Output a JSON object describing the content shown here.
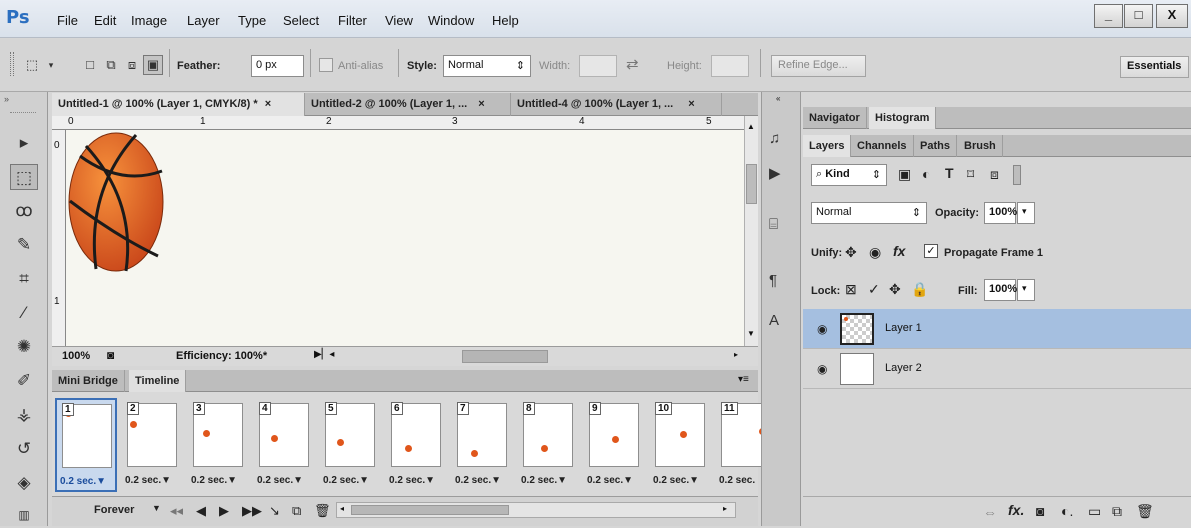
{
  "app": {
    "logo": "Ps"
  },
  "menu": [
    "File",
    "Edit",
    "Image",
    "Layer",
    "Type",
    "Select",
    "Filter",
    "View",
    "Window",
    "Help"
  ],
  "window_controls": {
    "minimize": "_",
    "maximize": "□",
    "close": "X"
  },
  "options": {
    "feather_label": "Feather:",
    "feather_value": "0 px",
    "antialias_label": "Anti-alias",
    "style_label": "Style:",
    "style_value": "Normal",
    "width_label": "Width:",
    "height_label": "Height:",
    "refine_edge": "Refine Edge...",
    "workspace": "Essentials"
  },
  "document_tabs": [
    {
      "label": "Untitled-1 @ 100% (Layer 1, CMYK/8) *",
      "close": "×"
    },
    {
      "label": "Untitled-2 @ 100% (Layer 1, ...",
      "close": "×"
    },
    {
      "label": "Untitled-4 @ 100% (Layer 1, ...",
      "close": "×"
    }
  ],
  "ruler": {
    "top": [
      "0",
      "1",
      "2",
      "3",
      "4",
      "5"
    ],
    "left": [
      "0",
      "1"
    ]
  },
  "status": {
    "zoom": "100%",
    "efficiency": "Efficiency: 100%*"
  },
  "panel_tabs": {
    "mini_bridge": "Mini Bridge",
    "timeline": "Timeline"
  },
  "frames": [
    {
      "num": "1",
      "time": "0.2 sec.▼",
      "ball_x": 0.05,
      "ball_y": 0.08
    },
    {
      "num": "2",
      "time": "0.2 sec.▼",
      "ball_x": 0.05,
      "ball_y": 0.3
    },
    {
      "num": "3",
      "time": "0.2 sec.▼",
      "ball_x": 0.2,
      "ball_y": 0.45
    },
    {
      "num": "4",
      "time": "0.2 sec.▼",
      "ball_x": 0.25,
      "ball_y": 0.55
    },
    {
      "num": "5",
      "time": "0.2 sec.▼",
      "ball_x": 0.25,
      "ball_y": 0.62
    },
    {
      "num": "6",
      "time": "0.2 sec.▼",
      "ball_x": 0.3,
      "ball_y": 0.72
    },
    {
      "num": "7",
      "time": "0.2 sec.▼",
      "ball_x": 0.3,
      "ball_y": 0.8
    },
    {
      "num": "8",
      "time": "0.2 sec.▼",
      "ball_x": 0.4,
      "ball_y": 0.72
    },
    {
      "num": "9",
      "time": "0.2 sec.▼",
      "ball_x": 0.5,
      "ball_y": 0.57
    },
    {
      "num": "10",
      "time": "0.2 sec.▼",
      "ball_x": 0.55,
      "ball_y": 0.48
    },
    {
      "num": "11",
      "time": "0.2 sec.",
      "ball_x": 0.85,
      "ball_y": 0.42
    }
  ],
  "timeline_controls": {
    "loop": "Forever"
  },
  "right_tabs_top": {
    "navigator": "Navigator",
    "histogram": "Histogram"
  },
  "right_tabs_layers": {
    "layers": "Layers",
    "channels": "Channels",
    "paths": "Paths",
    "brush": "Brush"
  },
  "layers_panel": {
    "kind": "Kind",
    "blend_mode": "Normal",
    "opacity_label": "Opacity:",
    "opacity_value": "100%",
    "unify_label": "Unify:",
    "propagate": "Propagate Frame 1",
    "lock_label": "Lock:",
    "fill_label": "Fill:",
    "fill_value": "100%",
    "layers": [
      {
        "name": "Layer 1",
        "selected": true
      },
      {
        "name": "Layer 2",
        "selected": false
      }
    ]
  },
  "colors": {
    "ball": "#e0561b",
    "selection": "#a5bfe0",
    "accent": "#2b6fc0"
  }
}
